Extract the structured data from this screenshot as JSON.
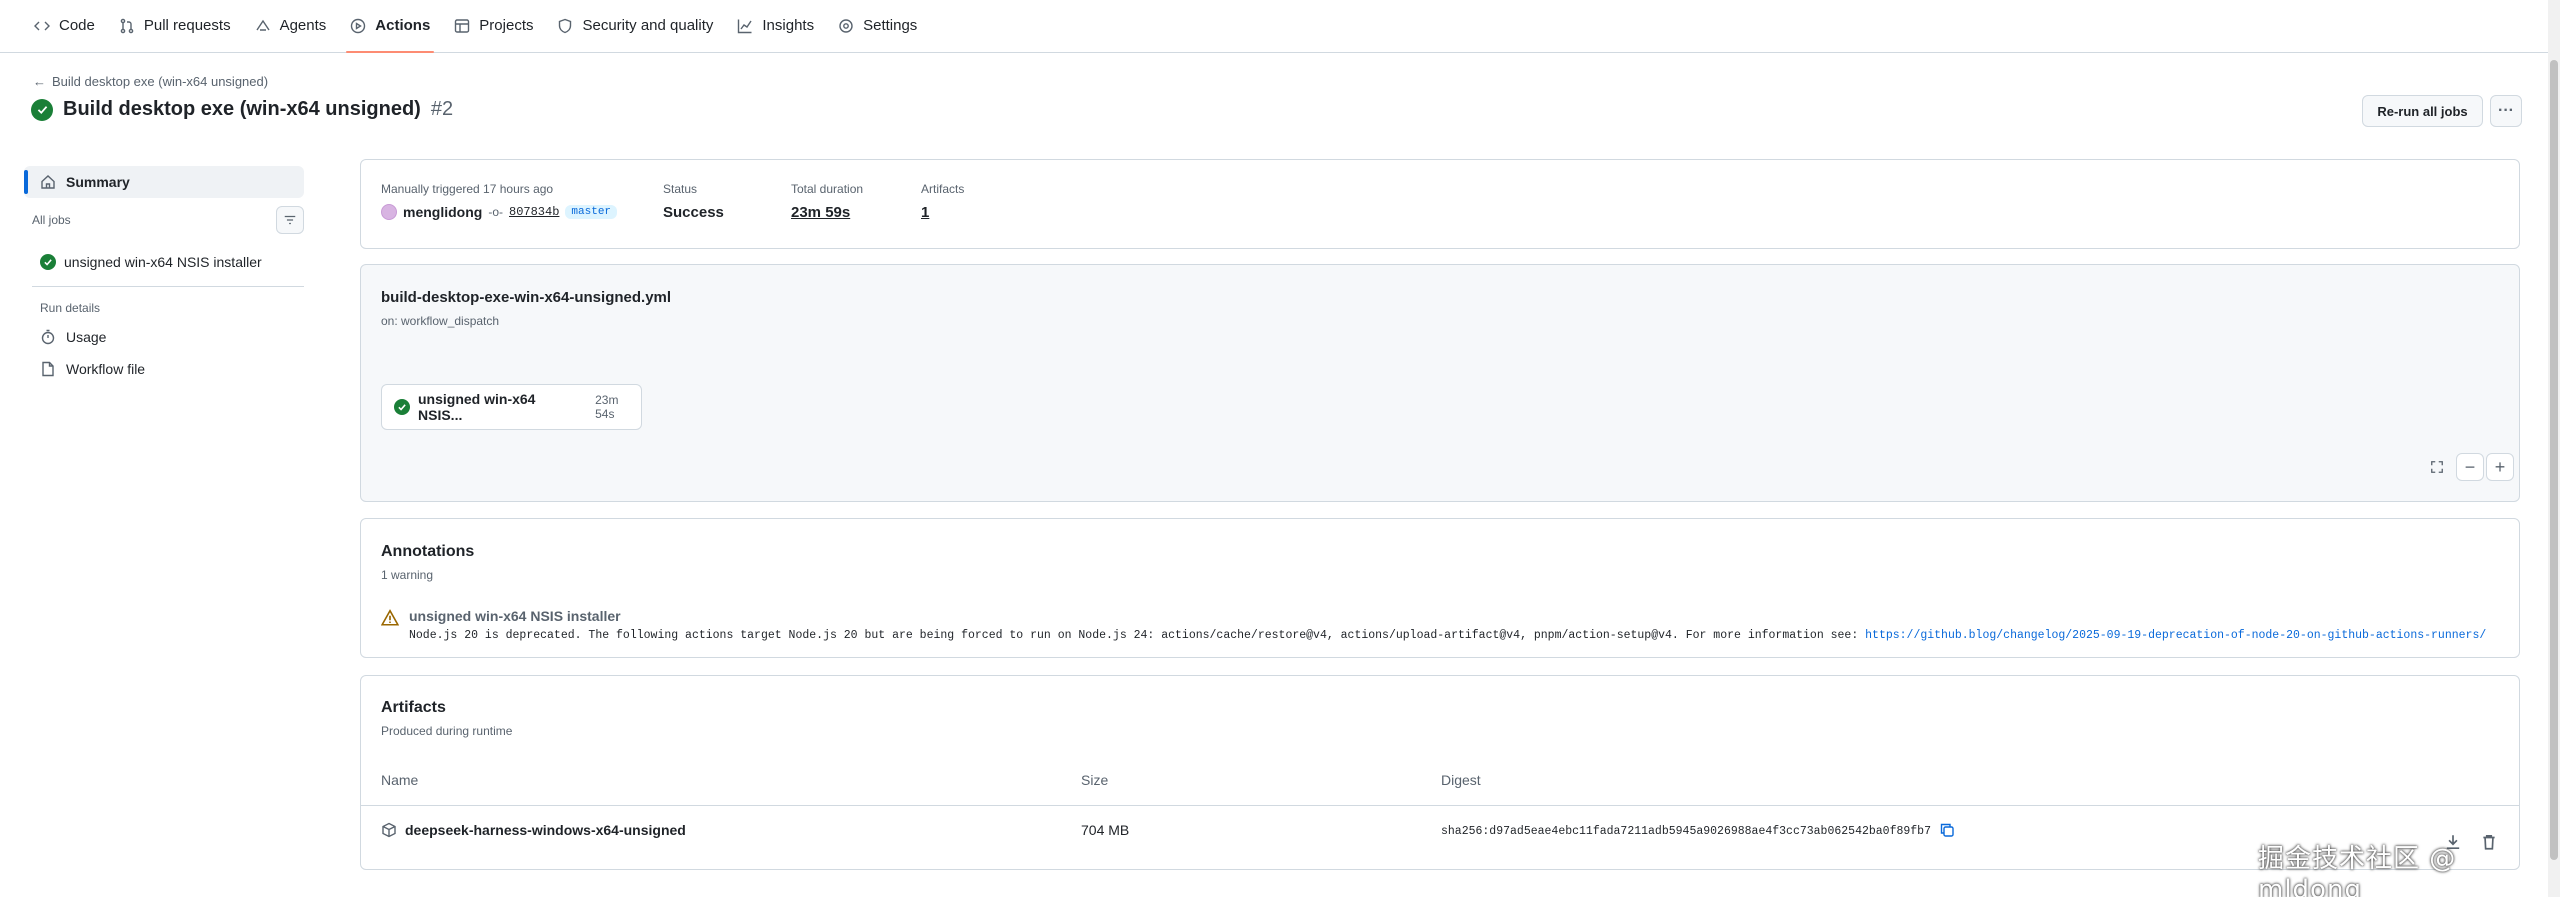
{
  "nav": {
    "tabs": [
      {
        "label": "Code",
        "icon": "code-icon"
      },
      {
        "label": "Pull requests",
        "icon": "pull-request-icon"
      },
      {
        "label": "Agents",
        "icon": "agents-icon"
      },
      {
        "label": "Actions",
        "icon": "play-icon",
        "active": true
      },
      {
        "label": "Projects",
        "icon": "table-icon"
      },
      {
        "label": "Security and quality",
        "icon": "shield-icon"
      },
      {
        "label": "Insights",
        "icon": "graph-icon"
      },
      {
        "label": "Settings",
        "icon": "gear-icon"
      }
    ]
  },
  "header": {
    "back_label": "Build desktop exe (win-x64 unsigned)",
    "title": "Build desktop exe (win-x64 unsigned)",
    "run_number": "#2",
    "rerun_label": "Re-run all jobs",
    "more_label": "···"
  },
  "sidebar": {
    "summary_label": "Summary",
    "all_jobs_label": "All jobs",
    "job_label": "unsigned win-x64 NSIS installer",
    "run_details_label": "Run details",
    "usage_label": "Usage",
    "workflow_file_label": "Workflow file"
  },
  "summary": {
    "trigger_label": "Manually triggered 17 hours ago",
    "user": "menglidong",
    "commit": "807834b",
    "branch": "master",
    "status_label": "Status",
    "status_value": "Success",
    "duration_label": "Total duration",
    "duration_value": "23m 59s",
    "artifacts_label": "Artifacts",
    "artifacts_value": "1"
  },
  "graph": {
    "workflow_file": "build-desktop-exe-win-x64-unsigned.yml",
    "trigger": "on: workflow_dispatch",
    "job_name": "unsigned win-x64 NSIS...",
    "job_duration": "23m 54s",
    "zoom_out": "−",
    "zoom_in": "+"
  },
  "annotations": {
    "heading": "Annotations",
    "count": "1 warning",
    "warning_title": "unsigned win-x64 NSIS installer",
    "warning_message": "Node.js 20 is deprecated. The following actions target Node.js 20 but are being forced to run on Node.js 24: actions/cache/restore@v4, actions/upload-artifact@v4, pnpm/action-setup@v4. For more information see: ",
    "warning_link": "https://github.blog/changelog/2025-09-19-deprecation-of-node-20-on-github-actions-runners/"
  },
  "artifacts": {
    "heading": "Artifacts",
    "subheading": "Produced during runtime",
    "columns": [
      "Name",
      "Size",
      "Digest"
    ],
    "rows": [
      {
        "name": "deepseek-harness-windows-x64-unsigned",
        "size": "704 MB",
        "digest": "sha256:d97ad5eae4ebc11fada7211adb5945a9026988ae4f3cc73ab062542ba0f89fb7"
      }
    ]
  },
  "watermark": "掘金技术社区 @ mldong",
  "colors": {
    "success": "#1a7f37",
    "accent": "#0969da",
    "active_tab_underline": "#fd8c73",
    "warning": "#9a6700"
  }
}
